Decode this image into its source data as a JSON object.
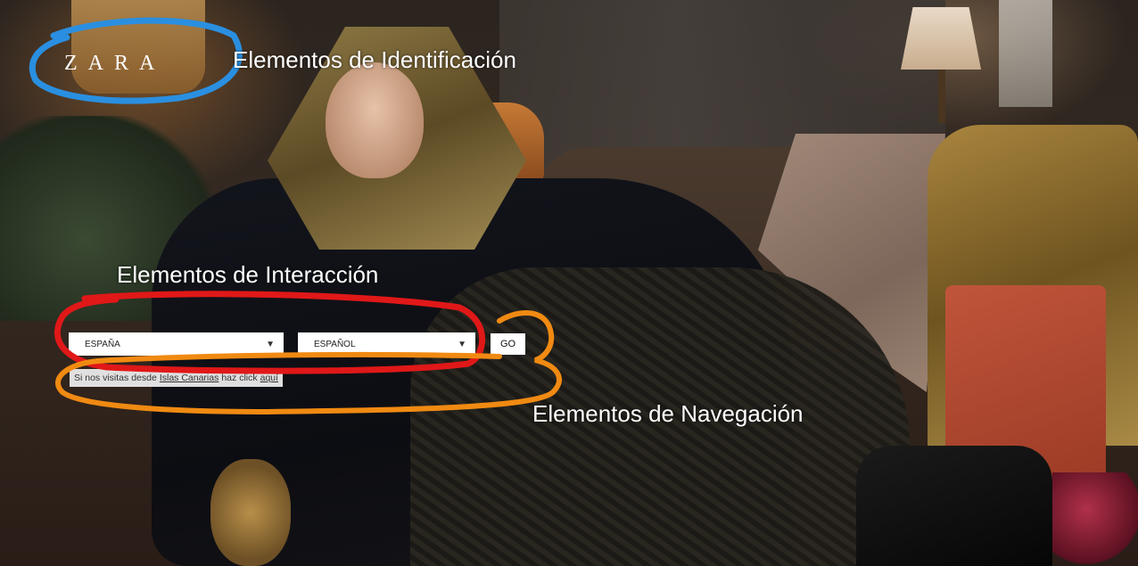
{
  "brand": {
    "logo_text": "ZARA"
  },
  "form": {
    "country_value": "ESPAÑA",
    "language_value": "ESPAÑOL",
    "go_label": "GO",
    "dropdown_arrow": "▼"
  },
  "canary_notice": {
    "prefix": "Si nos visitas desde",
    "link_region": "Islas Canarias",
    "middle": "haz click",
    "link_here": "aquí"
  },
  "annotations": {
    "identification": {
      "text": "Elementos de Identificación",
      "color": "#2a8fe0"
    },
    "interaction": {
      "text": "Elementos de Interacción",
      "color": "#e01818"
    },
    "navigation": {
      "text": "Elementos de Navegación",
      "color": "#f08a12"
    }
  }
}
